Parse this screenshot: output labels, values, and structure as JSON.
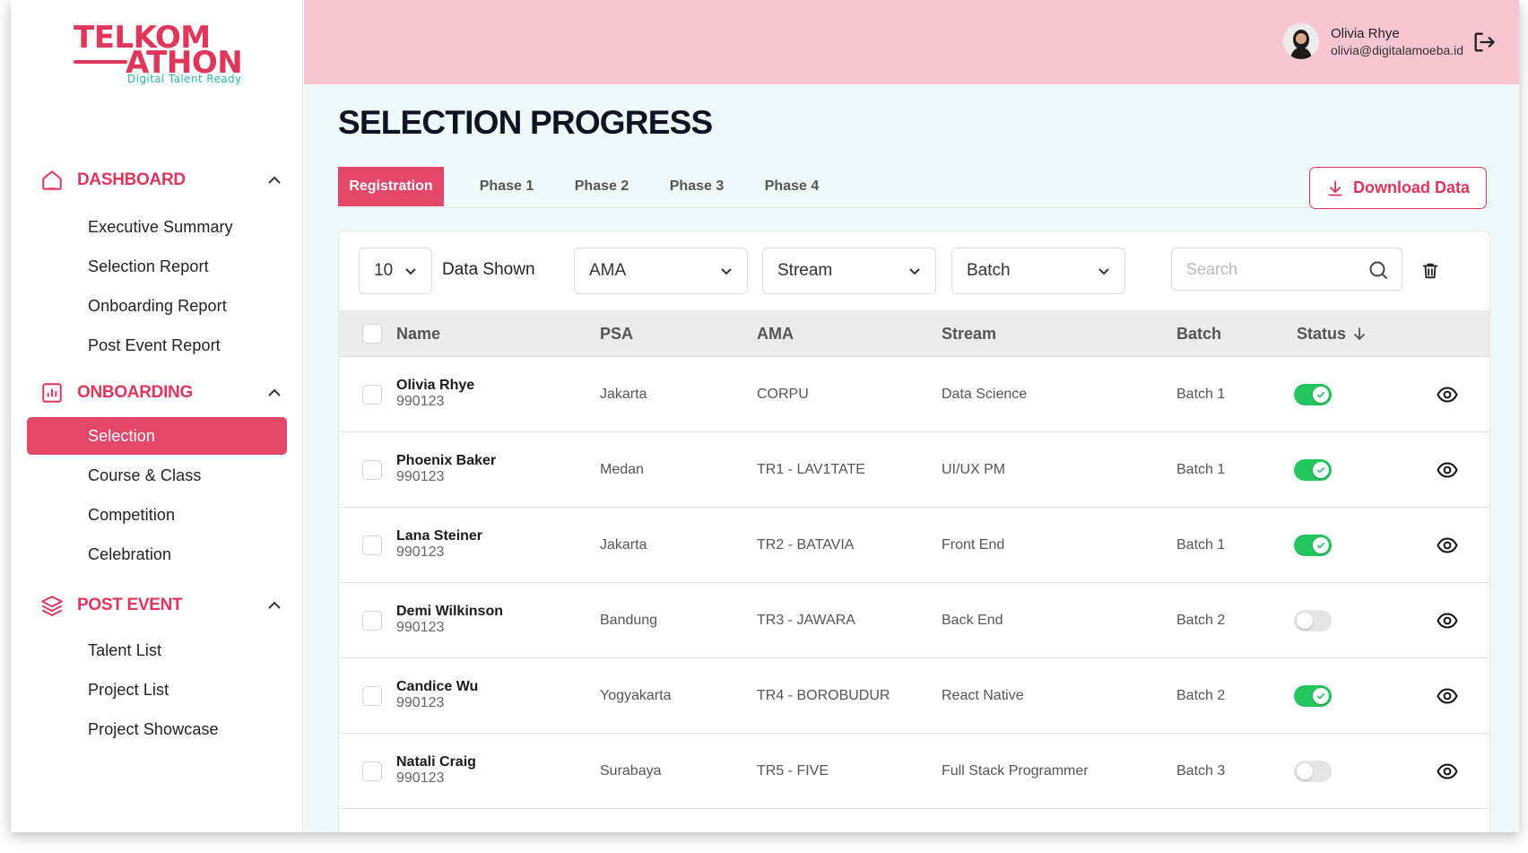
{
  "brand": {
    "line1": "TELKOM",
    "line2": "ATHON",
    "tagline": "Digital Talent Ready",
    "color": "#e0365c",
    "tag_color": "#2bb6a8"
  },
  "user": {
    "name": "Olivia Rhye",
    "email": "olivia@digitalamoeba.id",
    "logout_icon": "logout-icon"
  },
  "sidebar": {
    "sections": [
      {
        "label": "DASHBOARD",
        "icon": "home-icon",
        "items": [
          "Executive Summary",
          "Selection Report",
          "Onboarding Report",
          "Post Event Report"
        ]
      },
      {
        "label": "ONBOARDING",
        "icon": "bar-chart-icon",
        "items": [
          "Selection",
          "Course & Class",
          "Competition",
          "Celebration"
        ],
        "active": "Selection"
      },
      {
        "label": "POST EVENT",
        "icon": "layers-icon",
        "items": [
          "Talent List",
          "Project List",
          "Project Showcase"
        ]
      }
    ]
  },
  "page": {
    "title": "SELECTION PROGRESS"
  },
  "tabs": [
    {
      "label": "Registration",
      "active": true
    },
    {
      "label": "Phase 1",
      "active": false
    },
    {
      "label": "Phase 2",
      "active": false
    },
    {
      "label": "Phase 3",
      "active": false
    },
    {
      "label": "Phase 4",
      "active": false
    }
  ],
  "download_label": "Download Data",
  "filters": {
    "page_size": "10",
    "shown_label": "Data Shown",
    "ama": "AMA",
    "stream": "Stream",
    "batch": "Batch",
    "search_placeholder": "Search"
  },
  "table": {
    "columns": [
      "Name",
      "PSA",
      "AMA",
      "Stream",
      "Batch",
      "Status"
    ],
    "rows": [
      {
        "name": "Olivia Rhye",
        "id": "990123",
        "psa": "Jakarta",
        "ama": "CORPU",
        "stream": "Data Science",
        "batch": "Batch 1",
        "status": true
      },
      {
        "name": "Phoenix Baker",
        "id": "990123",
        "psa": "Medan",
        "ama": "TR1 - LAV1TATE",
        "stream": "UI/UX PM",
        "batch": "Batch 1",
        "status": true
      },
      {
        "name": "Lana Steiner",
        "id": "990123",
        "psa": "Jakarta",
        "ama": "TR2 - BATAVIA",
        "stream": "Front End",
        "batch": "Batch 1",
        "status": true
      },
      {
        "name": "Demi Wilkinson",
        "id": "990123",
        "psa": "Bandung",
        "ama": "TR3 - JAWARA",
        "stream": "Back End",
        "batch": "Batch 2",
        "status": false
      },
      {
        "name": "Candice Wu",
        "id": "990123",
        "psa": "Yogyakarta",
        "ama": "TR4 - BOROBUDUR",
        "stream": "React Native",
        "batch": "Batch 2",
        "status": true
      },
      {
        "name": "Natali Craig",
        "id": "990123",
        "psa": "Surabaya",
        "ama": "TR5 - FIVE",
        "stream": "Full Stack Programmer",
        "batch": "Batch 3",
        "status": false
      }
    ]
  },
  "colors": {
    "accent": "#e3486b",
    "header_bg": "#f8c6d0",
    "main_bg": "#eefaf7",
    "toggle_on": "#22c55e",
    "toggle_off": "#e5e5e5"
  }
}
